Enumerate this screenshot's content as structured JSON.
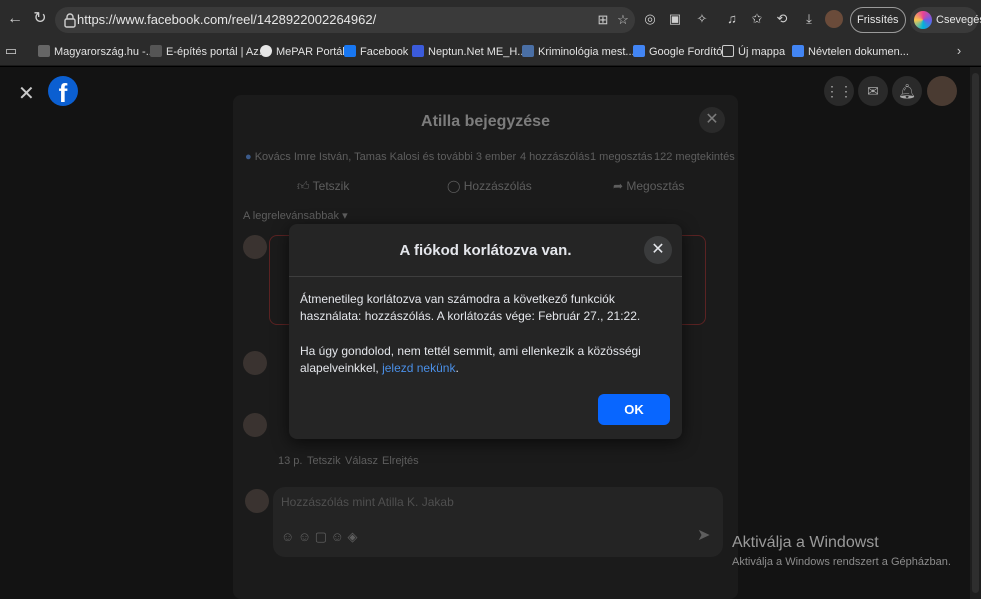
{
  "browser": {
    "url": "https://www.facebook.com/reel/1428922002264962/",
    "refresh_label": "Frissítés",
    "refresh_more": "···",
    "chat_label": "Csevegés"
  },
  "bookmarks": [
    {
      "label": "Magyarország.hu -...",
      "color": "#666666"
    },
    {
      "label": "E-építés portál | Az...",
      "color": "#555555"
    },
    {
      "label": "MePAR Portál",
      "color": "#e6e6e6"
    },
    {
      "label": "Facebook",
      "color": "#1877f2"
    },
    {
      "label": "Neptun.Net ME_H...",
      "color": "#3b5bdb"
    },
    {
      "label": "Kriminológia mest...",
      "color": "#4a6fa5"
    },
    {
      "label": "Google Fordító",
      "color": "#4285f4"
    },
    {
      "label": "Új mappa",
      "color": "#cccccc"
    },
    {
      "label": "Névtelen dokumen...",
      "color": "#4285f4"
    }
  ],
  "post": {
    "title": "Atilla bejegyzése",
    "reactions": "Kovács Imre István, Tamas Kalosi és további 3 ember",
    "comments_count": "4 hozzászólás",
    "shares": "1 megosztás",
    "views": "122 megtekintés",
    "like_label": "Tetszik",
    "comment_label": "Hozzászólás",
    "share_label": "Megosztás",
    "sort_label": "A legrelevánsabbak",
    "comment_time": "13 p.",
    "comment_like": "Tetszik",
    "comment_reply": "Válasz",
    "comment_hide": "Elrejtés",
    "comment_placeholder": "Hozzászólás mint Atilla K. Jakab"
  },
  "dialog": {
    "title": "A fiókod korlátozva van.",
    "paragraph1": "Átmenetileg korlátozva van számodra a következő funkciók használata: hozzászólás. A korlátozás vége: Február 27., 21:22.",
    "paragraph2_prefix": "Ha úgy gondolod, nem tettél semmit, ami ellenkezik a közösségi alapelveinkkel,",
    "paragraph2_link": "jelezd nekünk",
    "paragraph2_suffix": ".",
    "ok_label": "OK"
  },
  "watermark": {
    "title": "Aktiválja a Windowst",
    "subtitle": "Aktiválja a Windows rendszert a Gépházban."
  },
  "colors": {
    "ok_button": "#0866ff",
    "link": "#4a8fe7",
    "facebook_blue": "#0b5fd1"
  }
}
